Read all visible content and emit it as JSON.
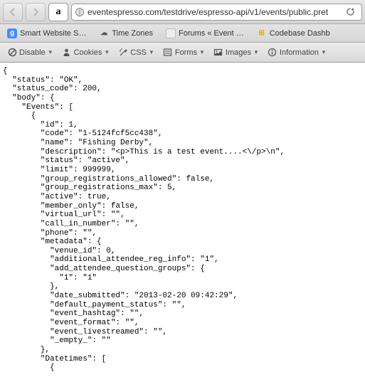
{
  "browser": {
    "url_text": "eventespresso.com/testdrive/espresso-api/v1/events/public.pret"
  },
  "bookmarks": {
    "items": [
      {
        "label": "Smart Website S…"
      },
      {
        "label": "Time Zones"
      },
      {
        "label": "Forums « Event …"
      },
      {
        "label": "Codebase Dashb"
      }
    ]
  },
  "devtoolbar": {
    "items": [
      {
        "label": "Disable"
      },
      {
        "label": "Cookies"
      },
      {
        "label": "CSS"
      },
      {
        "label": "Forms"
      },
      {
        "label": "Images"
      },
      {
        "label": "Information"
      }
    ]
  },
  "response": {
    "body_text": "{\n  \"status\": \"OK\",\n  \"status_code\": 200,\n  \"body\": {\n    \"Events\": [\n      {\n        \"id\": 1,\n        \"code\": \"1-5124fcf5cc438\",\n        \"name\": \"Fishing Derby\",\n        \"description\": \"<p>This is a test event....<\\/p>\\n\",\n        \"status\": \"active\",\n        \"limit\": 999999,\n        \"group_registrations_allowed\": false,\n        \"group_registrations_max\": 5,\n        \"active\": true,\n        \"member_only\": false,\n        \"virtual_url\": \"\",\n        \"call_in_number\": \"\",\n        \"phone\": \"\",\n        \"metadata\": {\n          \"venue_id\": 0,\n          \"additional_attendee_reg_info\": \"1\",\n          \"add_attendee_question_groups\": {\n            \"1\": \"1\"\n          },\n          \"date_submitted\": \"2013-02-20 09:42:29\",\n          \"default_payment_status\": \"\",\n          \"event_hashtag\": \"\",\n          \"event_format\": \"\",\n          \"event_livestreamed\": \"\",\n          \"_empty_\": \"\"\n        },\n        \"Datetimes\": [\n          {"
  },
  "chart_data": null
}
